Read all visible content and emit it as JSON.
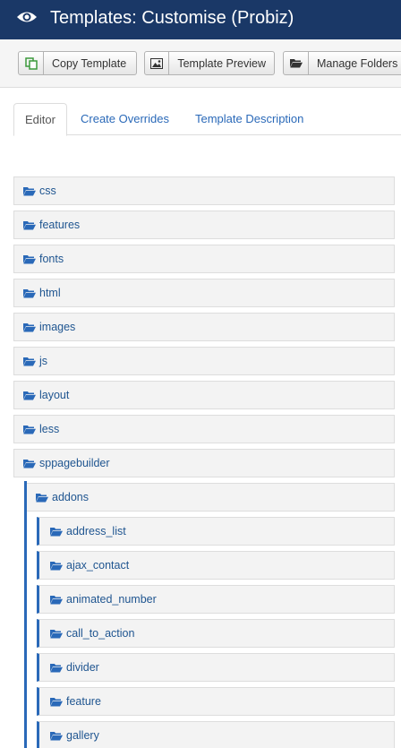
{
  "header": {
    "title": "Templates: Customise (Probiz)",
    "background": "#1a3867"
  },
  "toolbar": {
    "copy_label": "Copy Template",
    "preview_label": "Template Preview",
    "folders_label": "Manage Folders"
  },
  "tabs": [
    {
      "label": "Editor",
      "active": true
    },
    {
      "label": "Create Overrides",
      "active": false
    },
    {
      "label": "Template Description",
      "active": false
    }
  ],
  "tree": {
    "root_folders": [
      "css",
      "features",
      "fonts",
      "html",
      "images",
      "js",
      "layout",
      "less",
      "sppagebuilder"
    ],
    "sppagebuilder_children": [
      "addons"
    ],
    "addons_children": [
      "address_list",
      "ajax_contact",
      "animated_number",
      "call_to_action",
      "divider",
      "feature",
      "gallery"
    ]
  },
  "colors": {
    "link": "#2a69b8",
    "folder_icon": "#2a69b8",
    "row_background": "#f3f3f3"
  }
}
